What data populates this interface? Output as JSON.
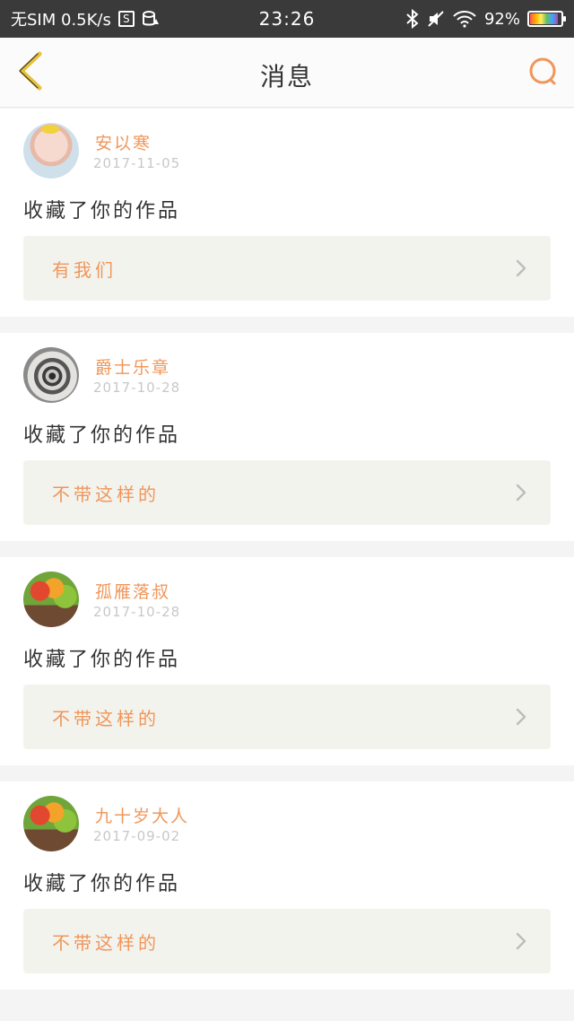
{
  "status_bar": {
    "carrier": "无SIM 0.5K/s",
    "s_icon_label": "S",
    "time": "23:26",
    "battery": "92%",
    "battery_level": 0.92
  },
  "header": {
    "title": "消息",
    "back_icon": "chevron-left-icon",
    "search_icon": "search-icon",
    "accent_color": "#f0965a",
    "back_color": "#e6c23c"
  },
  "messages": [
    {
      "name": "安以寒",
      "date": "2017-11-05",
      "action": "收藏了你的作品",
      "work_title": "有我们"
    },
    {
      "name": "爵士乐章",
      "date": "2017-10-28",
      "action": "收藏了你的作品",
      "work_title": "不带这样的"
    },
    {
      "name": "孤雁落叔",
      "date": "2017-10-28",
      "action": "收藏了你的作品",
      "work_title": "不带这样的"
    },
    {
      "name": "九十岁大人",
      "date": "2017-09-02",
      "action": "收藏了你的作品",
      "work_title": "不带这样的"
    }
  ]
}
